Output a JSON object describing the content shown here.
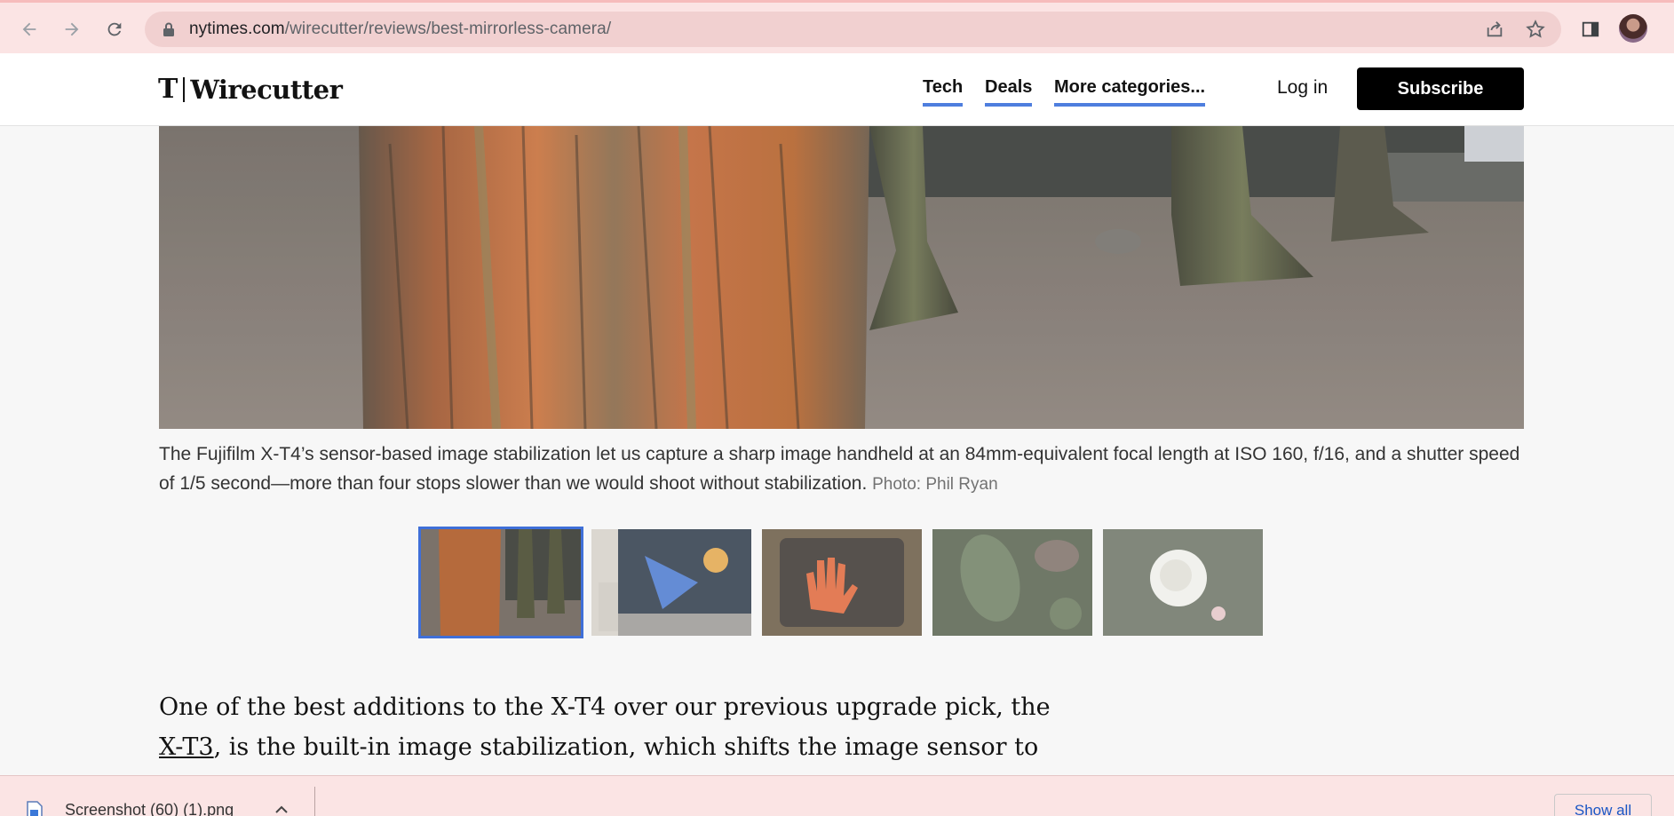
{
  "browser": {
    "url_domain": "nytimes.com",
    "url_path": "/wirecutter/reviews/best-mirrorless-camera/",
    "back_icon": "arrow-left-icon",
    "forward_icon": "arrow-right-icon",
    "reload_icon": "reload-icon"
  },
  "header": {
    "logo_mark": "T",
    "logo_word": "Wirecutter",
    "nav": [
      "Tech",
      "Deals",
      "More categories..."
    ],
    "login": "Log in",
    "subscribe": "Subscribe"
  },
  "gallery": {
    "caption": "The Fujifilm X-T4’s sensor-based image stabilization let us capture a sharp image handheld at an 84mm-equivalent focal length at ISO 160, f/16, and a shutter speed of 1/5 second—more than four stops slower than we would shoot without stabilization.",
    "credit": "Photo: Phil Ryan",
    "thumbnails": [
      "tree-trunk",
      "mural",
      "crosswalk-signal",
      "leaves",
      "white-rose"
    ],
    "active_index": 0
  },
  "article": {
    "text_before": "One of the best additions to the X-T4 over our previous upgrade pick, the ",
    "link": "X-T3",
    "text_after": ", is the built-in image stabilization, which shifts the image sensor to"
  },
  "downloads": {
    "file_name": "Screenshot (60) (1).png",
    "show_all": "Show all"
  },
  "colors": {
    "chrome_bg": "#fbe4e4",
    "nav_underline": "#4e7ede",
    "subscribe_bg": "#000000",
    "active_thumb": "#3f6fd8"
  }
}
